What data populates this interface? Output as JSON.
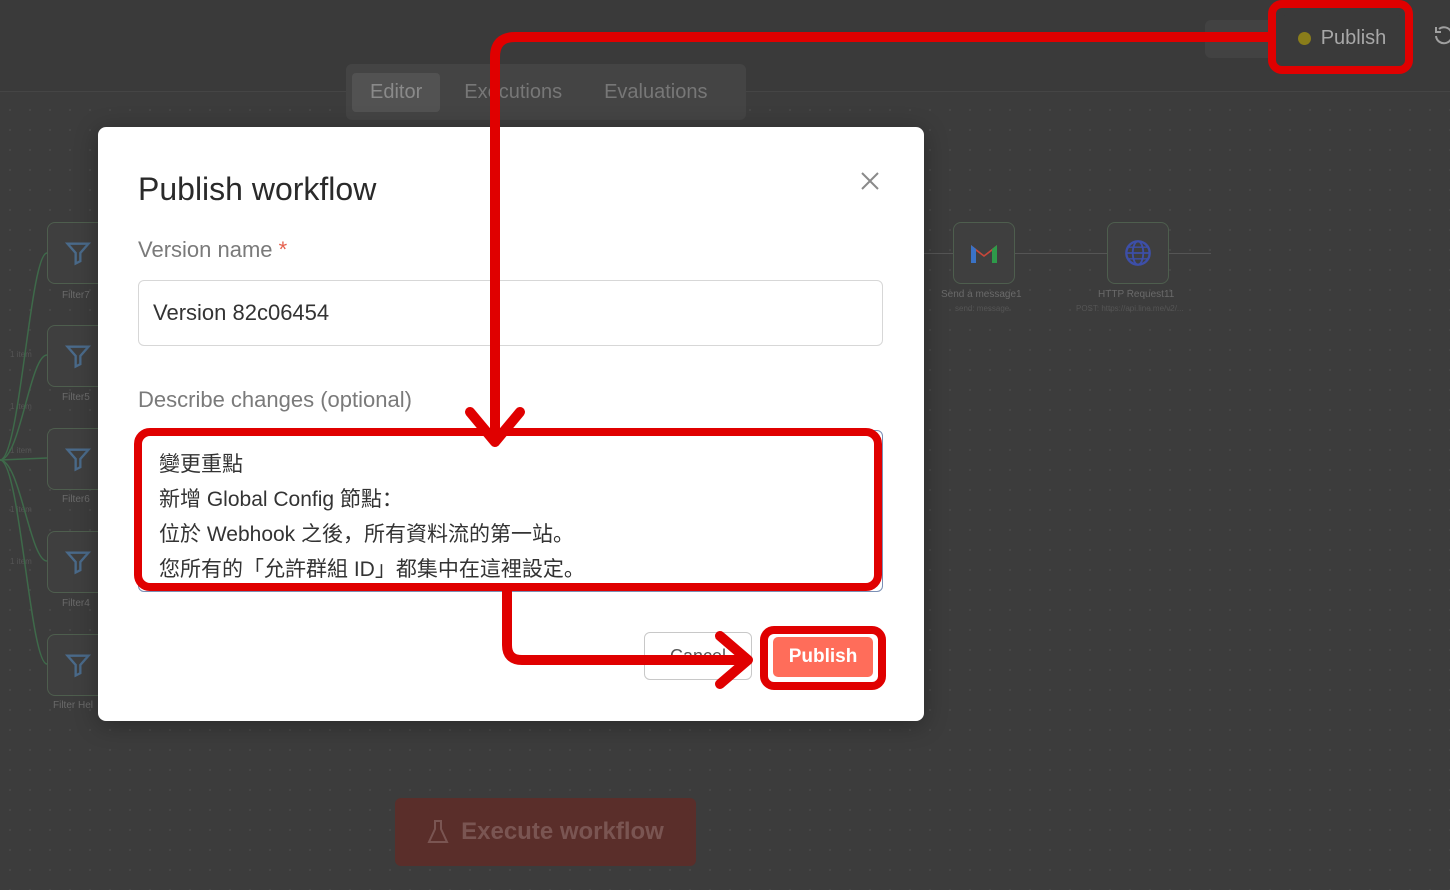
{
  "header": {
    "publish_label": "Publish",
    "history_icon": "history-icon",
    "tabs": [
      {
        "label": "Editor",
        "active": true
      },
      {
        "label": "Executions",
        "active": false
      },
      {
        "label": "Evaluations",
        "active": false
      }
    ]
  },
  "canvas": {
    "filter_nodes": [
      {
        "label": "Filter7"
      },
      {
        "label": "Filter5"
      },
      {
        "label": "Filter6"
      },
      {
        "label": "Filter4"
      },
      {
        "label": "Filter Hel"
      }
    ],
    "edge_labels": [
      "1 item",
      "1 item",
      "1 item",
      "1 item",
      "1 item"
    ],
    "send_node": {
      "label": "Send a message1",
      "sub": "send: message",
      "icon": "gmail-icon"
    },
    "http_node": {
      "label": "HTTP Request11",
      "sub": "POST: https://api.line.me/v2/...",
      "icon": "globe-icon"
    },
    "execute_label": "Execute workflow",
    "execute_icon": "flask-icon"
  },
  "modal": {
    "title": "Publish workflow",
    "version_label": "Version name",
    "required_mark": "*",
    "version_value": "Version 82c06454",
    "changes_label": "Describe changes (optional)",
    "changes_value": "變更重點\n新增 Global Config 節點：\n位於 Webhook 之後，所有資料流的第一站。\n您所有的「允許群組 ID」都集中在這裡設定。",
    "cancel_label": "Cancel",
    "publish_label": "Publish"
  },
  "colors": {
    "annotation_red": "#e00000",
    "publish_accent": "#ff6d5a",
    "status_dot": "#8a7d1a"
  }
}
